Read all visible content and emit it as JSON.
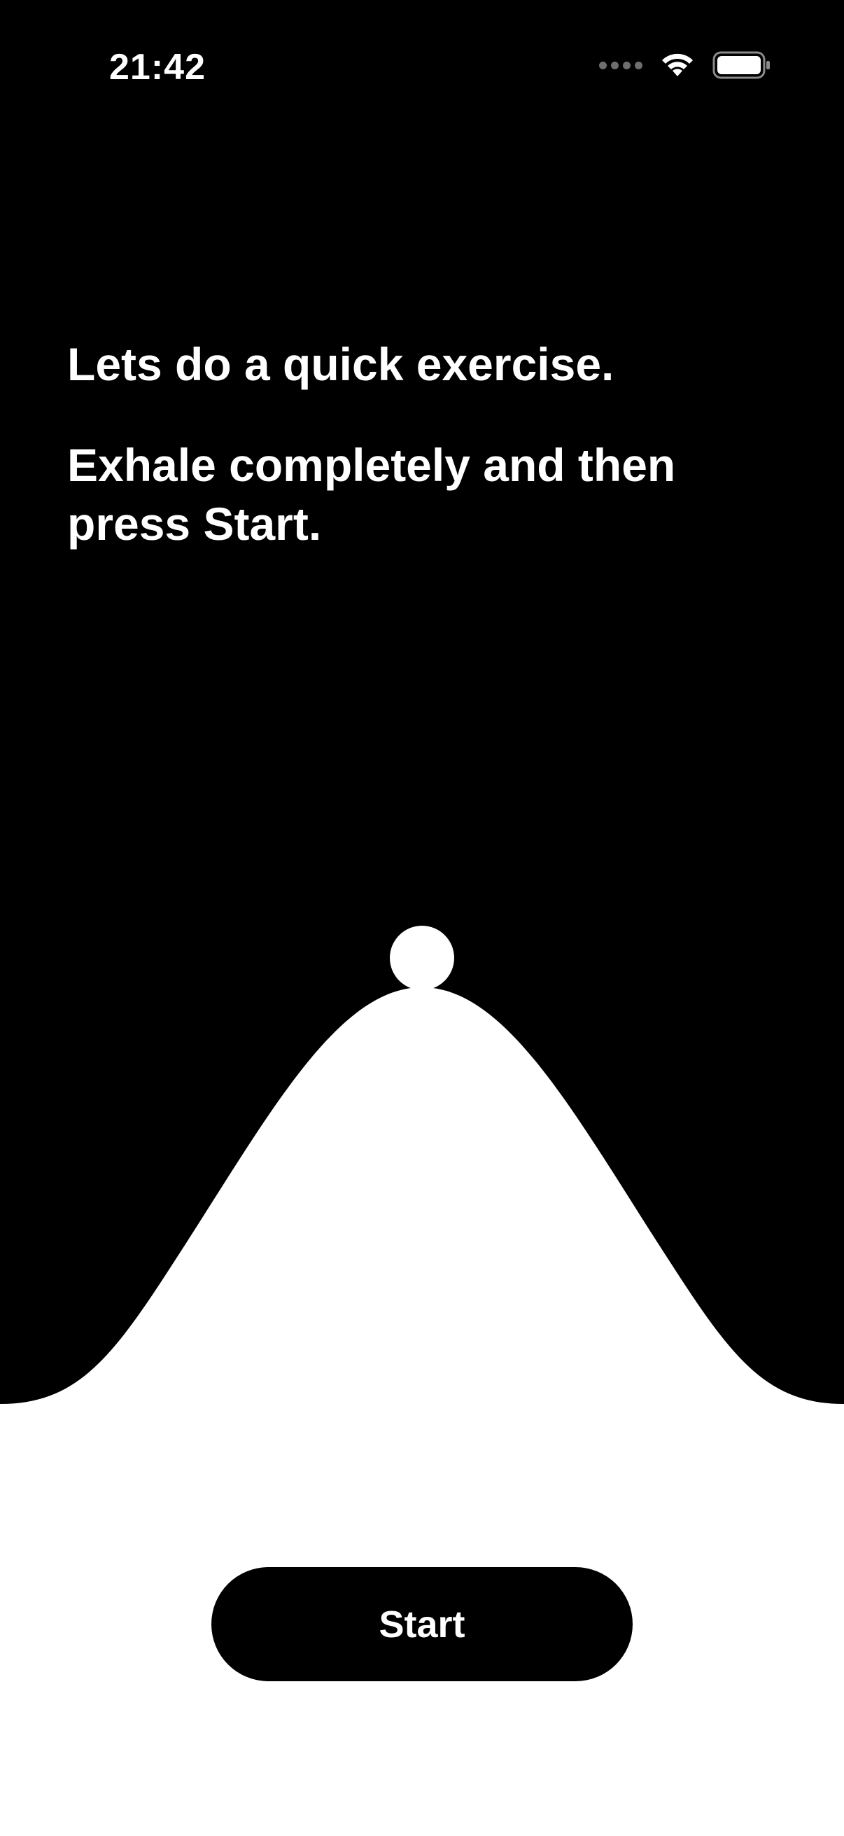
{
  "status_bar": {
    "time": "21:42",
    "icons": [
      "cellular-signal-icon",
      "wifi-icon",
      "battery-icon"
    ]
  },
  "prompt": {
    "headline": "Lets do a quick exercise.",
    "instruction": "Exhale completely and then press Start."
  },
  "start_button": {
    "label": "Start"
  },
  "colors": {
    "background_dark": "#000000",
    "foreground_light": "#ffffff",
    "button": "#000000",
    "signal_dots": "#6e6e6e"
  }
}
